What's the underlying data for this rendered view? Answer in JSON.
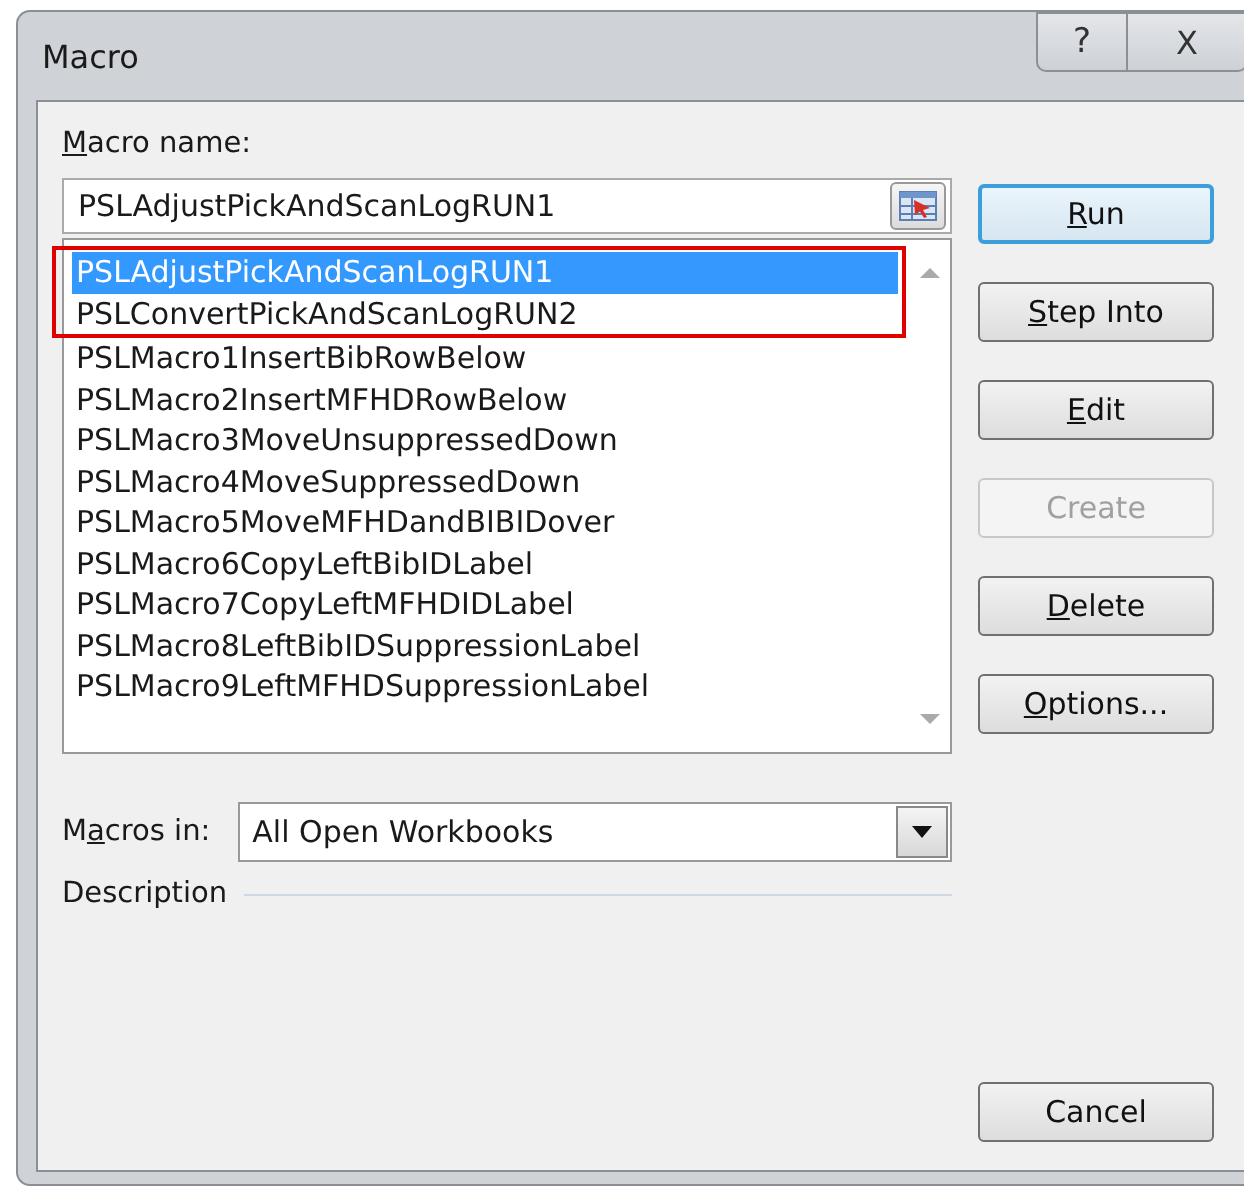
{
  "window": {
    "title": "Macro",
    "buttons": [
      {
        "kind": "help",
        "label": "?"
      },
      {
        "kind": "close",
        "label": "X"
      }
    ]
  },
  "macro_name": {
    "label": {
      "key": "M",
      "after": "acro name:"
    },
    "value": "PSLAdjustPickAndScanLogRUN1"
  },
  "macro_list": [
    {
      "name": "PSLAdjustPickAndScanLogRUN1",
      "selected": true,
      "outlined": true
    },
    {
      "name": "PSLConvertPickAndScanLogRUN2",
      "selected": false,
      "outlined": true
    },
    {
      "name": "PSLMacro1InsertBibRowBelow",
      "selected": false,
      "outlined": false
    },
    {
      "name": "PSLMacro2InsertMFHDRowBelow",
      "selected": false,
      "outlined": false
    },
    {
      "name": "PSLMacro3MoveUnsuppressedDown",
      "selected": false,
      "outlined": false
    },
    {
      "name": "PSLMacro4MoveSuppressedDown",
      "selected": false,
      "outlined": false
    },
    {
      "name": "PSLMacro5MoveMFHDandBIBIDover",
      "selected": false,
      "outlined": false
    },
    {
      "name": "PSLMacro6CopyLeftBibIDLabel",
      "selected": false,
      "outlined": false
    },
    {
      "name": "PSLMacro7CopyLeftMFHDIDLabel",
      "selected": false,
      "outlined": false
    },
    {
      "name": "PSLMacro8LeftBibIDSuppressionLabel",
      "selected": false,
      "outlined": false
    },
    {
      "name": "PSLMacro9LeftMFHDSuppressionLabel",
      "selected": false,
      "outlined": false
    }
  ],
  "macros_in": {
    "label": {
      "before": "M",
      "key": "a",
      "after": "cros in:"
    },
    "value": "All Open Workbooks"
  },
  "description": {
    "label": "Description"
  },
  "buttons": [
    {
      "label": {
        "key": "R",
        "after": "un"
      },
      "default": true,
      "disabled": false
    },
    {
      "label": {
        "key": "S",
        "after": "tep Into"
      },
      "default": false,
      "disabled": false
    },
    {
      "label": {
        "key": "E",
        "after": "dit"
      },
      "default": false,
      "disabled": false
    },
    {
      "label": {
        "before": "Create"
      },
      "default": false,
      "disabled": true
    },
    {
      "label": {
        "key": "D",
        "after": "elete"
      },
      "default": false,
      "disabled": false
    },
    {
      "label": {
        "key": "O",
        "after": "ptions..."
      },
      "default": false,
      "disabled": false
    }
  ],
  "cancel_button": {
    "label": "Cancel"
  }
}
